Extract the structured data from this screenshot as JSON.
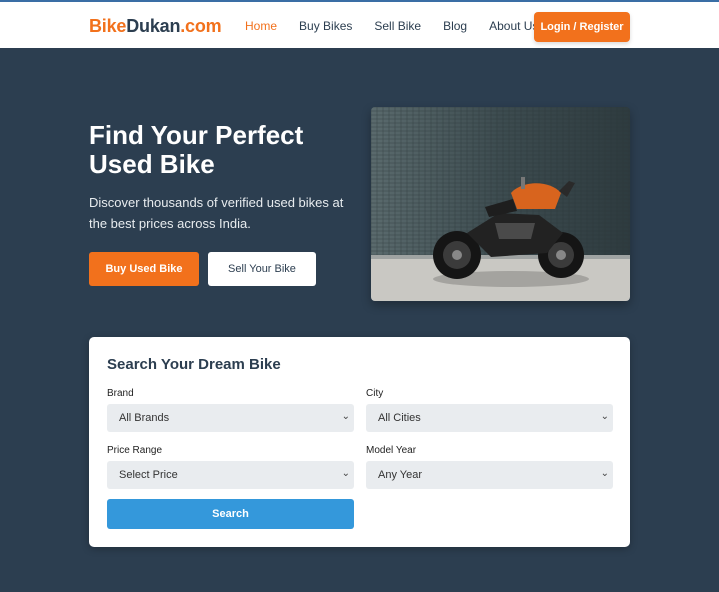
{
  "brand": {
    "part1": "Bike",
    "part2": "Dukan",
    "part3": ".com"
  },
  "nav": {
    "items": [
      {
        "label": "Home",
        "active": true
      },
      {
        "label": "Buy Bikes",
        "active": false
      },
      {
        "label": "Sell Bike",
        "active": false
      },
      {
        "label": "Blog",
        "active": false
      },
      {
        "label": "About Us",
        "active": false
      }
    ],
    "login_label": "Login / Register"
  },
  "hero": {
    "title": "Find Your Perfect Used Bike",
    "subtitle": "Discover thousands of verified used bikes at the best prices across India.",
    "buy_label": "Buy Used Bike",
    "sell_label": "Sell Your Bike",
    "image_icon": "motorcycle-photo"
  },
  "search": {
    "title": "Search Your Dream Bike",
    "brand_label": "Brand",
    "brand_value": "All Brands",
    "city_label": "City",
    "city_value": "All Cities",
    "price_label": "Price Range",
    "price_value": "Select Price",
    "year_label": "Model Year",
    "year_value": "Any Year",
    "button_label": "Search"
  },
  "colors": {
    "accent": "#f2711c",
    "background": "#2c3e50",
    "search_button": "#3498db"
  }
}
